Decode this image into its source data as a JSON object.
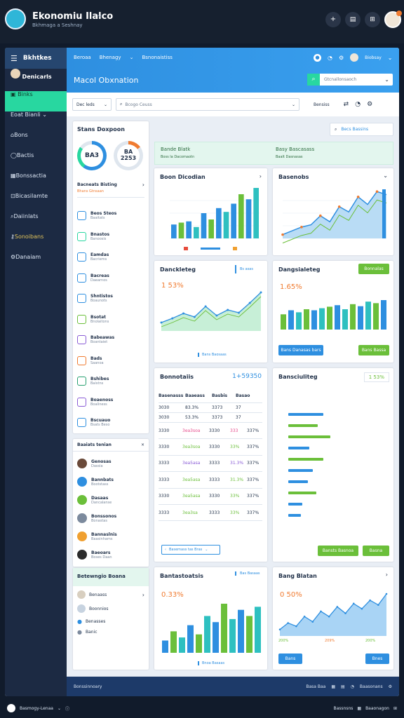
{
  "app": {
    "title": "Ekonomiu Ilalco",
    "subtitle": "Bkhmaga a Seshnay"
  },
  "sidebar": {
    "logo": "Bkhtkes",
    "profile": "Denicarls",
    "active": "Binks",
    "group": "Eoat Bianli",
    "items": [
      "Bons",
      "Bactis",
      "Bonssactia",
      "Bicasilamte",
      "Daiinlats",
      "Sonoibans",
      "Danaiam"
    ]
  },
  "header": {
    "nav": [
      "Beroaa",
      "Bhenagy",
      "Bsnonaistiss"
    ],
    "user": "Biobsay",
    "page_title": "Macol Obxnation",
    "search_placeholder": "Gtcnallonsaoch",
    "filter1": "Dec leds",
    "filter2": "Bcogo Ceuss",
    "filter3": "Bensiss",
    "date_search": "Becs Bassins"
  },
  "left_panel": {
    "title": "Stans Doxpoon",
    "gauge1": "BA3",
    "gauge2_top": "BA",
    "gauge2_bottom": "2253",
    "section": "Bacneats Bisting",
    "section_sub": "Bhans Gtnsaan",
    "list": [
      {
        "name": "Beos Steos",
        "sub": "Baaitats"
      },
      {
        "name": "Bnastos",
        "sub": "Banoosis"
      },
      {
        "name": "Eamdas",
        "sub": "Bacriems"
      },
      {
        "name": "Bacreas",
        "sub": "Daearnos"
      },
      {
        "name": "Shntistos",
        "sub": "Boaunots"
      },
      {
        "name": "Bsotat",
        "sub": "Bnolaitons"
      },
      {
        "name": "Babeawas",
        "sub": "Boantaiet"
      },
      {
        "name": "Bads",
        "sub": "Saanoa"
      },
      {
        "name": "Bshibes",
        "sub": "Baistns"
      },
      {
        "name": "Boaenoss",
        "sub": "Boaliness"
      },
      {
        "name": "Bscuauo",
        "sub": "Bsats Beso"
      }
    ],
    "contacts_title": "Baaiats tenian",
    "contacts": [
      {
        "name": "Genosas",
        "sub": "Dassia"
      },
      {
        "name": "Bannbats",
        "sub": "Bootstass"
      },
      {
        "name": "Dasaas",
        "sub": "Dancalanse"
      },
      {
        "name": "Bonssonos",
        "sub": "Bonastas"
      },
      {
        "name": "Bannaslnis",
        "sub": "Baasinhams"
      },
      {
        "name": "Baeoars",
        "sub": "Boses Daan"
      }
    ],
    "footer_title": "Betewngio Boana",
    "footer_items": [
      "Benaass",
      "Boonnios",
      "Benasses",
      "Banic"
    ]
  },
  "banner": {
    "left": "Bande Blatk",
    "left_sub": "Boss la Dacomaotn",
    "right": "Basy Bascasass",
    "right_sub": "Baalt Dasnasas"
  },
  "cards": {
    "c1": {
      "title": "Boon Dicodian"
    },
    "c2": {
      "title": "Basenobs"
    },
    "c3": {
      "title": "Danckleteg",
      "value": "1 53%",
      "button": "Bans Baosaas",
      "tag": "Bs asas"
    },
    "c4": {
      "title": "Dangsialeteg",
      "value": "1.65%",
      "button_left": "Bans Danasas bars",
      "button_right": "Bans Bassa",
      "tag": "Bonnalas"
    },
    "c5": {
      "title": "Bonnotaiis",
      "value": "1+59350",
      "pager": "Basemass tas Bras"
    },
    "c6": {
      "title": "Bansciuliteg",
      "value": "1 53%",
      "button_left": "Bansts Basnoa",
      "button_right": "Basna"
    },
    "c7": {
      "title": "Bantastoatsis",
      "value": "0.33%",
      "tag": "Bas Basaas",
      "button": "Bnoa Basaas"
    },
    "c8": {
      "title": "Bang Blatan",
      "value": "0 50%",
      "stat_left": "200%",
      "stat_mid": "209%",
      "stat_right": "200%",
      "button_left": "Bans",
      "button_right": "Bnes"
    }
  },
  "table": {
    "headers": [
      "Basenasss",
      "Baaeass",
      "Basbis",
      "Basao"
    ],
    "rows": [
      [
        "3030",
        "83.3%",
        "3373",
        "37"
      ],
      [
        "3030",
        "53.3%",
        "3373",
        "37"
      ],
      [
        "3330",
        "3ea3soa",
        "3330",
        "333",
        "337%"
      ],
      [
        "3330",
        "3ea3soa",
        "3330",
        "33%",
        "337%"
      ],
      [
        "3333",
        "3ea5asa",
        "3333",
        "31.3%",
        "337%"
      ],
      [
        "3333",
        "3ea5asa",
        "3333",
        "31.3%",
        "337%"
      ],
      [
        "3330",
        "3ea5asa",
        "3330",
        "33%",
        "337%"
      ],
      [
        "3333",
        "3ea3sa",
        "3333",
        "33%",
        "337%"
      ]
    ]
  },
  "status_bar": {
    "left": "Bonssinnoary",
    "right1": "Basa Baa",
    "right2": "Baasonans"
  },
  "taskbar": {
    "left": "Basmogy-Lenaa",
    "right1": "Bassnsns",
    "right2": "Baaonagon"
  },
  "colors": {
    "accent_green": "#28d7a0",
    "blue": "#2e8fe0",
    "green": "#6bbf3a",
    "orange": "#f07b30"
  },
  "charts": {
    "bars1": {
      "values": [
        22,
        25,
        27,
        18,
        40,
        30,
        48,
        42,
        55,
        70,
        62,
        80
      ]
    },
    "area1": {
      "values": [
        5,
        10,
        15,
        18,
        30,
        22,
        42,
        35,
        55,
        45,
        62,
        58
      ]
    },
    "line3": {
      "values": [
        12,
        18,
        25,
        20,
        35,
        22,
        30,
        26,
        40,
        55
      ]
    },
    "bars4": {
      "values": [
        30,
        38,
        34,
        40,
        38,
        42,
        45,
        48,
        40,
        50,
        46,
        55,
        52,
        58
      ]
    },
    "bars7": {
      "values": [
        20,
        35,
        25,
        45,
        30,
        60,
        50,
        80,
        55,
        70,
        60,
        75
      ]
    },
    "area8": {
      "values": [
        10,
        20,
        15,
        30,
        22,
        38,
        30,
        45,
        35,
        50,
        42,
        55,
        48,
        65
      ]
    }
  }
}
